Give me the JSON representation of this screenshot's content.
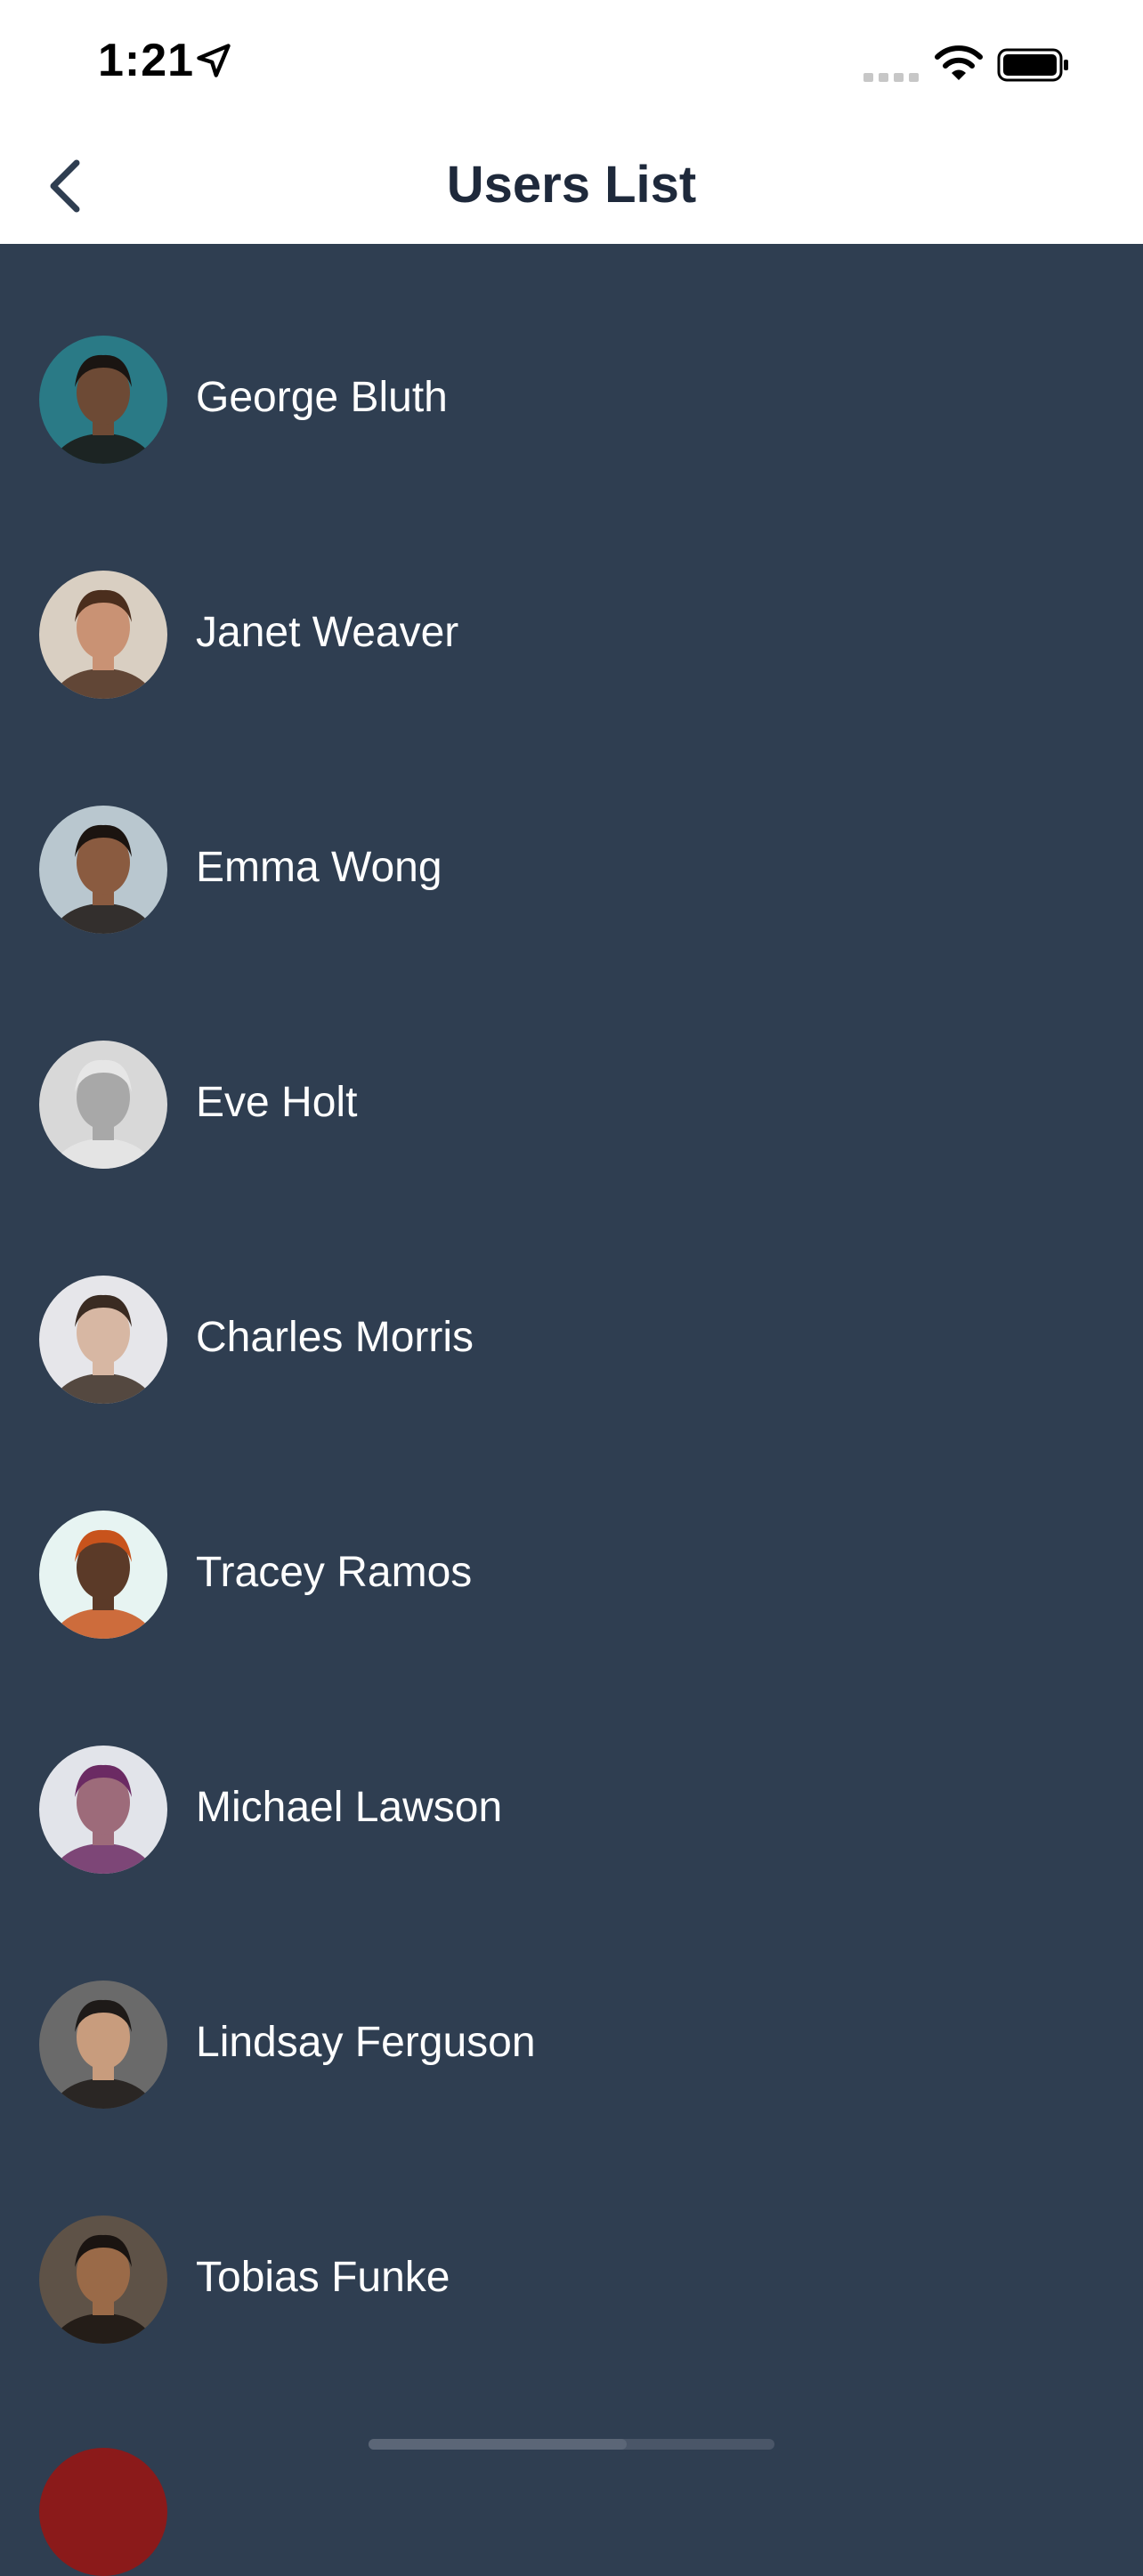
{
  "status_bar": {
    "time": "1:21",
    "icons": [
      "location-arrow-icon",
      "cellular-signal-icon",
      "wifi-icon",
      "battery-icon"
    ]
  },
  "nav": {
    "title": "Users List",
    "back_icon": "chevron-left-icon"
  },
  "colors": {
    "list_background": "#2f3e51",
    "header_background": "#ffffff",
    "title_color": "#1e293b",
    "name_color": "#ffffff"
  },
  "users": [
    {
      "name": "George Bluth",
      "avatar_bg": "#2a7a86",
      "skin": "#6d4a35",
      "hair": "#1a1512"
    },
    {
      "name": "Janet Weaver",
      "avatar_bg": "#d9cfc2",
      "skin": "#c99274",
      "hair": "#4b2e1d"
    },
    {
      "name": "Emma Wong",
      "avatar_bg": "#b9c7cf",
      "skin": "#8a5b40",
      "hair": "#1b1410"
    },
    {
      "name": "Eve Holt",
      "avatar_bg": "#d8d8d8",
      "skin": "#a8a8a8",
      "hair": "#e6e6e6"
    },
    {
      "name": "Charles Morris",
      "avatar_bg": "#e6e6ea",
      "skin": "#d7b7a3",
      "hair": "#3a2b22"
    },
    {
      "name": "Tracey Ramos",
      "avatar_bg": "#e7f4f2",
      "skin": "#5b3a28",
      "hair": "#c8531c"
    },
    {
      "name": "Michael Lawson",
      "avatar_bg": "#e2e4ea",
      "skin": "#9d6b7a",
      "hair": "#6b2a63"
    },
    {
      "name": "Lindsay Ferguson",
      "avatar_bg": "#6a6a6a",
      "skin": "#c89c7d",
      "hair": "#1e1a18"
    },
    {
      "name": "Tobias Funke",
      "avatar_bg": "#5e5247",
      "skin": "#9a6a48",
      "hair": "#1a1411"
    }
  ]
}
